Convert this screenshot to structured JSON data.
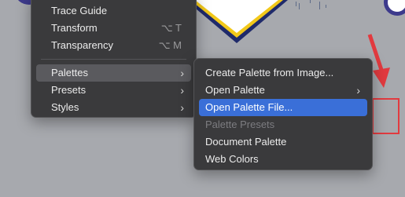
{
  "main_menu": {
    "items": [
      {
        "label": "Trace Guide",
        "shortcut": "",
        "submenu": false
      },
      {
        "label": "Transform",
        "shortcut": "⌥ T",
        "submenu": false
      },
      {
        "label": "Transparency",
        "shortcut": "⌥ M",
        "submenu": false
      },
      {
        "label": "Palettes",
        "shortcut": "",
        "submenu": true
      },
      {
        "label": "Presets",
        "shortcut": "",
        "submenu": true
      },
      {
        "label": "Styles",
        "shortcut": "",
        "submenu": true
      }
    ]
  },
  "palettes_submenu": {
    "items": [
      {
        "label": "Create Palette from Image...",
        "submenu": false,
        "state": "enabled"
      },
      {
        "label": "Open Palette",
        "submenu": true,
        "state": "enabled"
      },
      {
        "label": "Open Palette File...",
        "submenu": false,
        "state": "highlighted"
      },
      {
        "label": "Palette Presets",
        "submenu": false,
        "state": "disabled"
      },
      {
        "label": "Document Palette",
        "submenu": false,
        "state": "enabled"
      },
      {
        "label": "Web Colors",
        "submenu": false,
        "state": "enabled"
      }
    ]
  },
  "icons": {
    "submenu_chevron": "chevron-right-icon",
    "pointer_arrow": "red-arrow-annotation"
  },
  "colors": {
    "menu_bg": "#3a3a3c",
    "highlight": "#3a6fd8",
    "annotation": "#e23a3f",
    "canvas_bg": "#a7a9ae"
  }
}
